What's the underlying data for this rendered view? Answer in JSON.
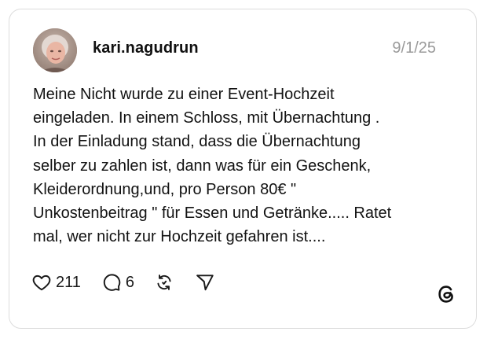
{
  "post": {
    "username": "kari.nagudrun",
    "date": "9/1/25",
    "text": "Meine Nicht wurde zu einer Event-Hochzeit\neingeladen. In einem Schloss, mit Übernachtung .\nIn der Einladung stand, dass die Übernachtung\nselber zu zahlen ist, dann was für ein Geschenk,\nKleiderordnung,und, pro Person 80€ \"\nUnkostenbeitrag \" für Essen und Getränke..... Ratet\nmal, wer nicht zur Hochzeit gefahren ist....",
    "avatar": "profile-photo"
  },
  "actions": {
    "like_count": "211",
    "reply_count": "6",
    "like_icon": "heart-icon",
    "reply_icon": "comment-icon",
    "repost_icon": "repost-icon",
    "share_icon": "send-icon"
  },
  "brand": {
    "logo": "threads-logo"
  },
  "colors": {
    "text": "#101010",
    "muted": "#9a9a9a",
    "border": "#dcdcdc"
  }
}
